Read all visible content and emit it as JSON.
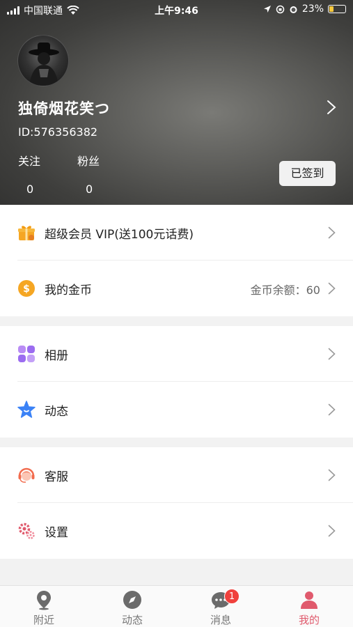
{
  "status_bar": {
    "carrier": "中国联通",
    "time": "上午9:46",
    "battery": "23%"
  },
  "profile": {
    "username": "独倚烟花笑つ",
    "user_id": "ID:576356382",
    "follow_label": "关注",
    "follow_count": "0",
    "fans_label": "粉丝",
    "fans_count": "0",
    "checkin_label": "已签到"
  },
  "menu_groups": [
    {
      "items": [
        {
          "label": "超级会员 VIP(送100元话费)",
          "icon": "gift-icon"
        },
        {
          "label": "我的金币",
          "icon": "coin-icon",
          "extra": "金币余额：60"
        }
      ]
    },
    {
      "items": [
        {
          "label": "相册",
          "icon": "album-icon"
        },
        {
          "label": "动态",
          "icon": "star-icon"
        }
      ]
    },
    {
      "items": [
        {
          "label": "客服",
          "icon": "customer-service-icon"
        },
        {
          "label": "设置",
          "icon": "gear-icon"
        }
      ]
    }
  ],
  "tabbar": {
    "tabs": [
      {
        "label": "附近",
        "icon": "location-pin-icon"
      },
      {
        "label": "动态",
        "icon": "compass-icon"
      },
      {
        "label": "消息",
        "icon": "chat-bubble-icon",
        "badge": "1"
      },
      {
        "label": "我的",
        "icon": "person-icon",
        "active": true
      }
    ]
  },
  "colors": {
    "accent": "#e05a6d",
    "badge": "#f0413d"
  }
}
